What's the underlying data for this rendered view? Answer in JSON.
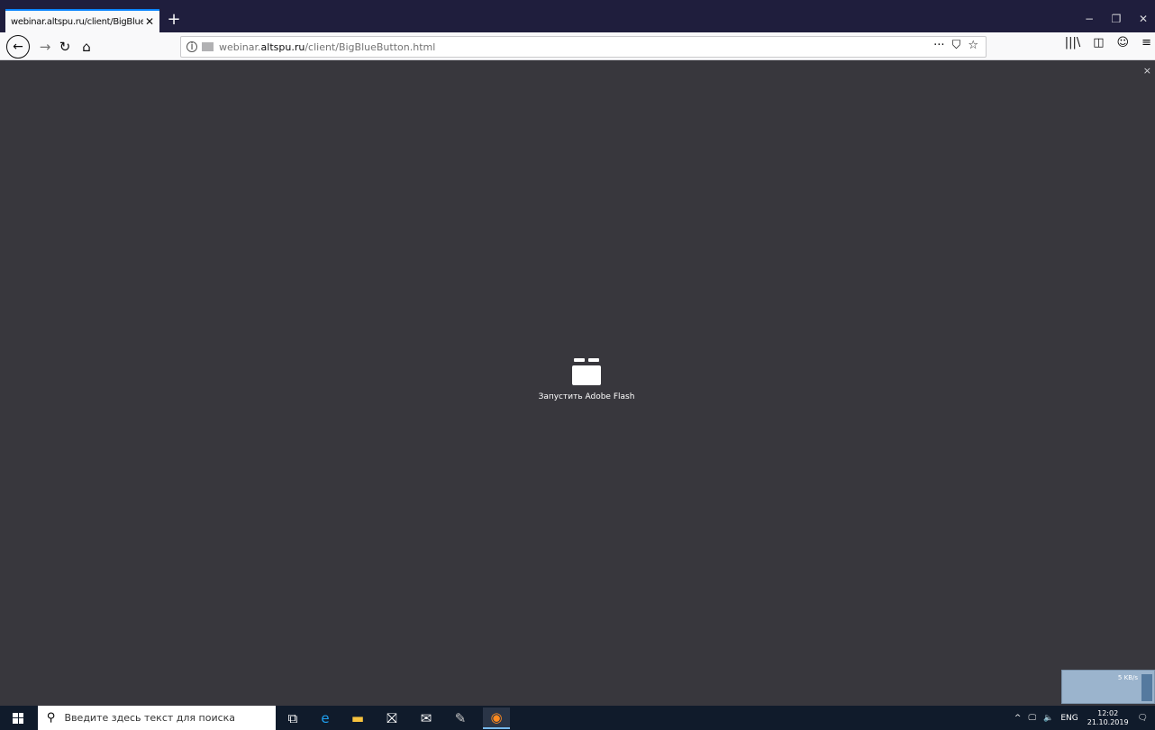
{
  "browser": {
    "tab": {
      "title": "webinar.altspu.ru/client/BigBlueBu",
      "close": "✕"
    },
    "new_tab": "+",
    "window_controls": {
      "minimize": "−",
      "restore": "❐",
      "close": "✕"
    },
    "nav": {
      "back": "←",
      "forward": "→",
      "reload": "↻",
      "home": "⌂"
    },
    "url": {
      "prefix": "webinar.",
      "host": "altspu.ru",
      "path": "/client/BigBlueButton.html"
    },
    "url_actions": {
      "more": "···",
      "pocket": "⛉",
      "bookmark": "☆"
    },
    "toolbar": {
      "library": "|||\\",
      "sidebar": "◫",
      "account": "☺",
      "menu": "≡"
    }
  },
  "content": {
    "close": "×",
    "flash_label": "Запустить Adobe Flash",
    "net_widget": "5 KB/s"
  },
  "taskbar": {
    "search_placeholder": "Введите здесь текст для поиска",
    "apps": [
      {
        "name": "task-view",
        "glyph": "⧉",
        "color": "#ffffff"
      },
      {
        "name": "edge",
        "glyph": "e",
        "color": "#1fa0f0"
      },
      {
        "name": "file-explorer",
        "glyph": "▬",
        "color": "#f7c33e"
      },
      {
        "name": "store",
        "glyph": "⛝",
        "color": "#ffffff"
      },
      {
        "name": "mail",
        "glyph": "✉",
        "color": "#ffffff"
      },
      {
        "name": "paint",
        "glyph": "✎",
        "color": "#c8c8c8"
      },
      {
        "name": "firefox",
        "glyph": "◉",
        "color": "#ff8a1f"
      }
    ],
    "tray": {
      "chevron": "^",
      "network": "🖵",
      "volume": "🔈",
      "lang": "ENG",
      "time": "12:02",
      "date": "21.10.2019",
      "notifications": "🗨"
    }
  }
}
